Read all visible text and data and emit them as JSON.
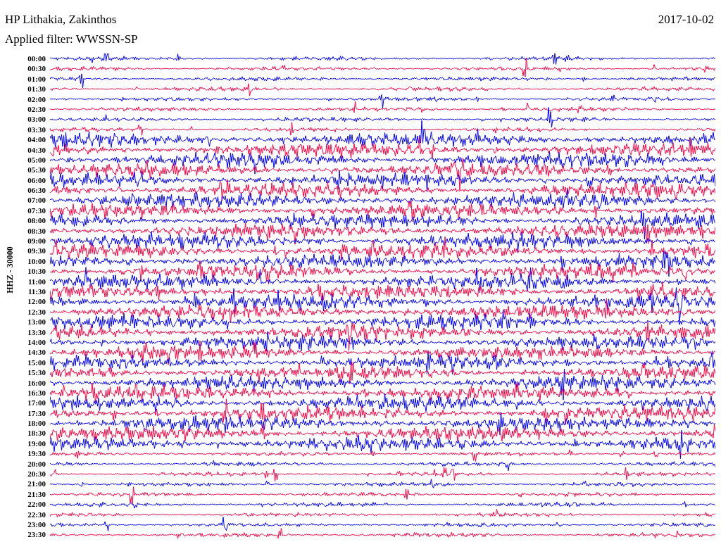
{
  "header": {
    "station": "HP Lithakia, Zakinthos",
    "date": "2017-10-02",
    "filter": "Applied filter: WWSSN-SP"
  },
  "channel_label": "HHZ - 30000",
  "traces": [
    {
      "time": "00:00",
      "color": "#0000ff"
    },
    {
      "time": "00:30",
      "color": "#ff0040"
    },
    {
      "time": "01:00",
      "color": "#0000ff"
    },
    {
      "time": "01:30",
      "color": "#ff0040"
    },
    {
      "time": "02:00",
      "color": "#0000ff"
    },
    {
      "time": "02:30",
      "color": "#ff0040"
    },
    {
      "time": "03:00",
      "color": "#0000ff"
    },
    {
      "time": "03:30",
      "color": "#ff0040"
    },
    {
      "time": "04:00",
      "color": "#0000ff"
    },
    {
      "time": "04:30",
      "color": "#ff0040"
    },
    {
      "time": "05:00",
      "color": "#0000ff"
    },
    {
      "time": "05:30",
      "color": "#ff0040"
    },
    {
      "time": "06:00",
      "color": "#0000ff"
    },
    {
      "time": "06:30",
      "color": "#ff0040"
    },
    {
      "time": "07:00",
      "color": "#0000ff"
    },
    {
      "time": "07:30",
      "color": "#ff0040"
    },
    {
      "time": "08:00",
      "color": "#0000ff"
    },
    {
      "time": "08:30",
      "color": "#ff0040"
    },
    {
      "time": "09:00",
      "color": "#0000ff"
    },
    {
      "time": "09:30",
      "color": "#ff0040"
    },
    {
      "time": "10:00",
      "color": "#0000ff"
    },
    {
      "time": "10:30",
      "color": "#ff0040"
    },
    {
      "time": "11:00",
      "color": "#0000ff"
    },
    {
      "time": "11:30",
      "color": "#ff0040"
    },
    {
      "time": "12:00",
      "color": "#0000ff"
    },
    {
      "time": "12:30",
      "color": "#ff0040"
    },
    {
      "time": "13:00",
      "color": "#0000ff"
    },
    {
      "time": "13:30",
      "color": "#ff0040"
    },
    {
      "time": "14:00",
      "color": "#0000ff"
    },
    {
      "time": "14:30",
      "color": "#ff0040"
    },
    {
      "time": "15:00",
      "color": "#0000ff"
    },
    {
      "time": "15:30",
      "color": "#ff0040"
    },
    {
      "time": "16:00",
      "color": "#0000ff"
    },
    {
      "time": "16:30",
      "color": "#ff0040"
    },
    {
      "time": "17:00",
      "color": "#0000ff"
    },
    {
      "time": "17:30",
      "color": "#ff0040"
    },
    {
      "time": "18:00",
      "color": "#0000ff"
    },
    {
      "time": "18:30",
      "color": "#ff0040"
    },
    {
      "time": "19:00",
      "color": "#0000ff"
    },
    {
      "time": "19:30",
      "color": "#ff0040"
    },
    {
      "time": "20:00",
      "color": "#0000ff"
    },
    {
      "time": "20:30",
      "color": "#ff0040"
    },
    {
      "time": "21:00",
      "color": "#0000ff"
    },
    {
      "time": "21:30",
      "color": "#ff0040"
    },
    {
      "time": "22:00",
      "color": "#0000ff"
    },
    {
      "time": "22:30",
      "color": "#ff0040"
    },
    {
      "time": "23:00",
      "color": "#0000ff"
    },
    {
      "time": "23:30",
      "color": "#ff0040"
    }
  ]
}
